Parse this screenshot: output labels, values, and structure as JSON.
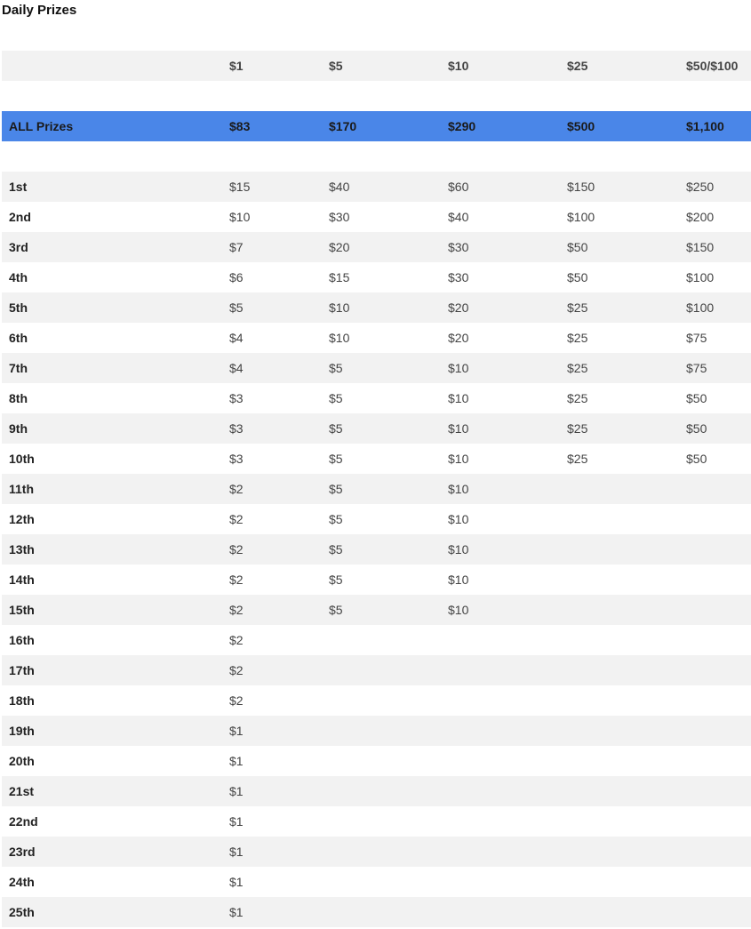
{
  "page": {
    "title": "Daily Prizes"
  },
  "table": {
    "header": [
      "",
      "$1",
      "$5",
      "$10",
      "$25",
      "$50/$100"
    ],
    "totals": [
      "ALL Prizes",
      "$83",
      "$170",
      "$290",
      "$500",
      "$1,100"
    ],
    "rows": [
      [
        "1st",
        "$15",
        "$40",
        "$60",
        "$150",
        "$250"
      ],
      [
        "2nd",
        "$10",
        "$30",
        "$40",
        "$100",
        "$200"
      ],
      [
        "3rd",
        "$7",
        "$20",
        "$30",
        "$50",
        "$150"
      ],
      [
        "4th",
        "$6",
        "$15",
        "$30",
        "$50",
        "$100"
      ],
      [
        "5th",
        "$5",
        "$10",
        "$20",
        "$25",
        "$100"
      ],
      [
        "6th",
        "$4",
        "$10",
        "$20",
        "$25",
        "$75"
      ],
      [
        "7th",
        "$4",
        "$5",
        "$10",
        "$25",
        "$75"
      ],
      [
        "8th",
        "$3",
        "$5",
        "$10",
        "$25",
        "$50"
      ],
      [
        "9th",
        "$3",
        "$5",
        "$10",
        "$25",
        "$50"
      ],
      [
        "10th",
        "$3",
        "$5",
        "$10",
        "$25",
        "$50"
      ],
      [
        "11th",
        "$2",
        "$5",
        "$10",
        "",
        ""
      ],
      [
        "12th",
        "$2",
        "$5",
        "$10",
        "",
        ""
      ],
      [
        "13th",
        "$2",
        "$5",
        "$10",
        "",
        ""
      ],
      [
        "14th",
        "$2",
        "$5",
        "$10",
        "",
        ""
      ],
      [
        "15th",
        "$2",
        "$5",
        "$10",
        "",
        ""
      ],
      [
        "16th",
        "$2",
        "",
        "",
        "",
        ""
      ],
      [
        "17th",
        "$2",
        "",
        "",
        "",
        ""
      ],
      [
        "18th",
        "$2",
        "",
        "",
        "",
        ""
      ],
      [
        "19th",
        "$1",
        "",
        "",
        "",
        ""
      ],
      [
        "20th",
        "$1",
        "",
        "",
        "",
        ""
      ],
      [
        "21st",
        "$1",
        "",
        "",
        "",
        ""
      ],
      [
        "22nd",
        "$1",
        "",
        "",
        "",
        ""
      ],
      [
        "23rd",
        "$1",
        "",
        "",
        "",
        ""
      ],
      [
        "24th",
        "$1",
        "",
        "",
        "",
        ""
      ],
      [
        "25th",
        "$1",
        "",
        "",
        "",
        ""
      ]
    ]
  },
  "colors": {
    "highlight_row": "#4a86e8",
    "shaded_row": "#f2f2f2"
  }
}
